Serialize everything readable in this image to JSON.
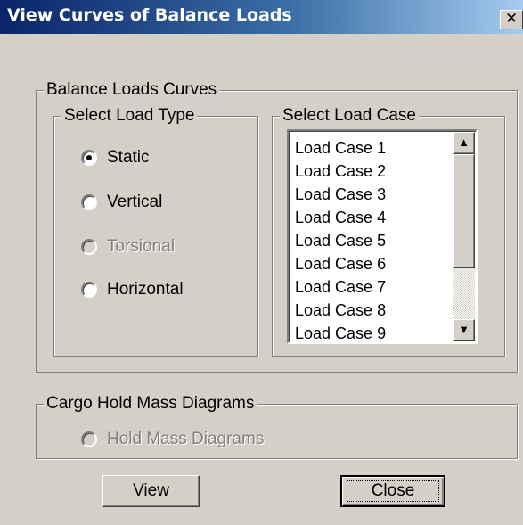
{
  "window": {
    "title": "View Curves of Balance Loads",
    "close_glyph": "✕"
  },
  "balance_group": {
    "legend": "Balance Loads Curves",
    "load_type": {
      "legend": "Select Load Type",
      "options": [
        {
          "label": "Static",
          "checked": true,
          "enabled": true
        },
        {
          "label": "Vertical",
          "checked": false,
          "enabled": true
        },
        {
          "label": "Torsional",
          "checked": false,
          "enabled": false
        },
        {
          "label": "Horizontal",
          "checked": false,
          "enabled": true
        }
      ]
    },
    "load_case": {
      "legend": "Select Load Case",
      "items": [
        "Load Case 1",
        "Load Case 2",
        "Load Case 3",
        "Load Case 4",
        "Load Case 5",
        "Load Case 6",
        "Load Case 7",
        "Load Case 8",
        "Load Case 9"
      ],
      "scroll_up_glyph": "▲",
      "scroll_down_glyph": "▼"
    }
  },
  "cargo_group": {
    "legend": "Cargo Hold Mass Diagrams",
    "option": {
      "label": "Hold Mass Diagrams",
      "checked": false,
      "enabled": false
    }
  },
  "buttons": {
    "view_label": "View",
    "close_label": "Close"
  }
}
